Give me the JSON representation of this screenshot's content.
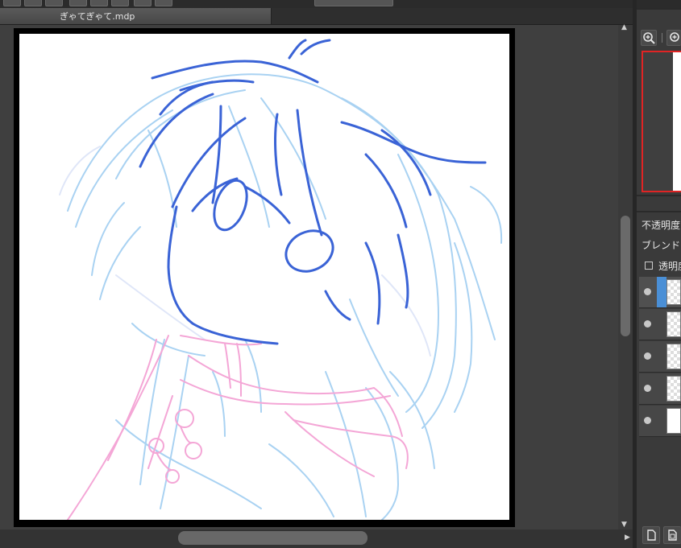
{
  "document": {
    "tab_title": "ぎゃてぎゃて.mdp"
  },
  "colors": {
    "line_dark": "#3a63d6",
    "line_light": "#9ccbf0",
    "line_pink": "#f5a8d8",
    "layer_selected": "#4a8fd6",
    "navigator_border": "#e02424"
  },
  "navigator": {
    "zoom_in_icon": "zoom-in-icon",
    "zoom_plus_icon": "zoom-plus-icon"
  },
  "layer_properties": {
    "opacity_label": "不透明度",
    "blend_label": "ブレンド",
    "preserve_alpha_label": "透明度",
    "preserve_alpha_checked": false
  },
  "layers": [
    {
      "visible": true,
      "selected": true,
      "transparent": true
    },
    {
      "visible": true,
      "selected": false,
      "transparent": true
    },
    {
      "visible": true,
      "selected": false,
      "transparent": true
    },
    {
      "visible": true,
      "selected": false,
      "transparent": true
    },
    {
      "visible": true,
      "selected": false,
      "transparent": false
    }
  ],
  "layer_buttons": [
    "new-layer-icon",
    "new-layer-from-file-icon"
  ]
}
